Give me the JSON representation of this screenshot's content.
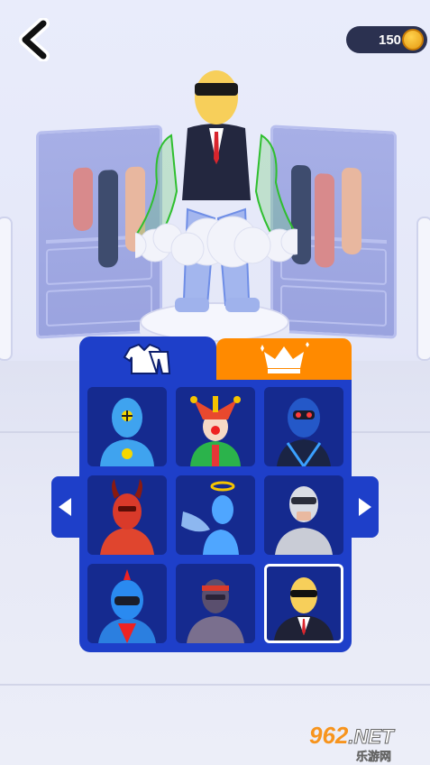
{
  "header": {
    "back_icon": "chevron-left-icon",
    "coins": "150",
    "coin_icon": "coin-icon"
  },
  "tabs": [
    {
      "id": "outfits",
      "icon": "clothes-icon",
      "active": true,
      "color": "#1e3fc9"
    },
    {
      "id": "premium",
      "icon": "crown-icon",
      "active": false,
      "color": "#ff8a00"
    }
  ],
  "pager": {
    "prev_icon": "triangle-left-icon",
    "next_icon": "triangle-right-icon"
  },
  "skins": [
    {
      "name": "crash-test-dummy",
      "selected": false
    },
    {
      "name": "jester",
      "selected": false
    },
    {
      "name": "cyber-mask",
      "selected": false
    },
    {
      "name": "red-devil",
      "selected": false
    },
    {
      "name": "angel",
      "selected": false
    },
    {
      "name": "robot-cop",
      "selected": false
    },
    {
      "name": "racer-helmet",
      "selected": false
    },
    {
      "name": "ninja",
      "selected": false
    },
    {
      "name": "agent-suit",
      "selected": true
    }
  ],
  "colors": {
    "panel": "#1e3fc9",
    "cell": "#152a8f",
    "premium_tab": "#ff8a00",
    "coin_pill": "#2b3150"
  },
  "watermark": {
    "brand": "962",
    "suffix": ".NET",
    "sub": "乐游网"
  }
}
